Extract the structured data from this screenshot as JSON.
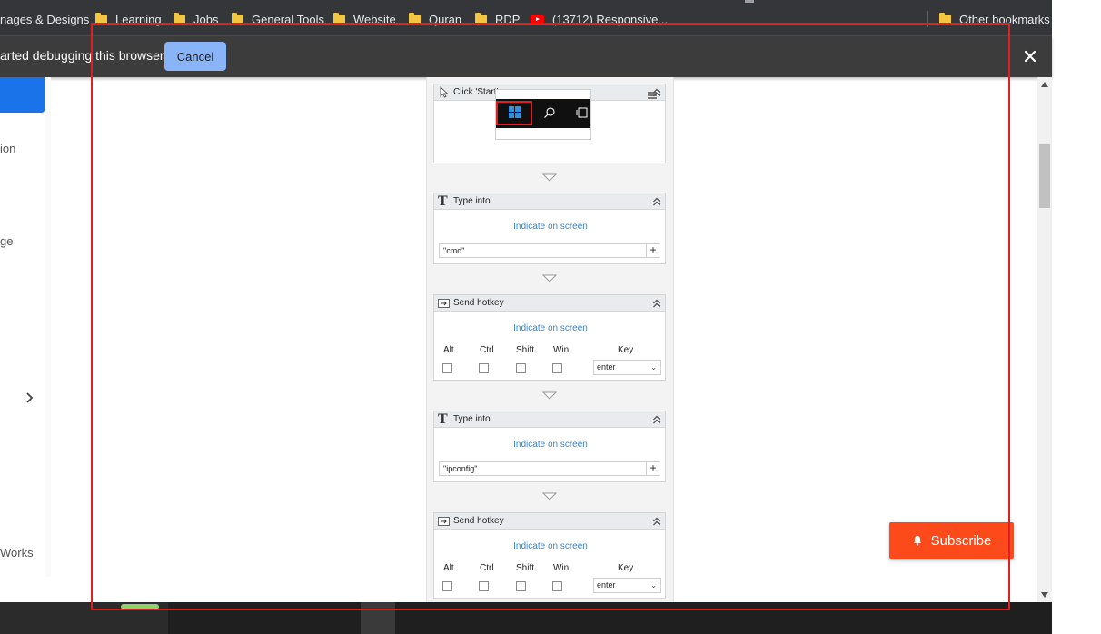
{
  "bookmarks": {
    "items": [
      {
        "label": "nages & Designs",
        "icon": ""
      },
      {
        "label": "Learning",
        "icon": "folder-icon"
      },
      {
        "label": "Jobs",
        "icon": "folder-icon"
      },
      {
        "label": "General Tools",
        "icon": "folder-icon"
      },
      {
        "label": "Website",
        "icon": "folder-icon"
      },
      {
        "label": "Quran",
        "icon": "folder-icon"
      },
      {
        "label": "RDP",
        "icon": "folder-icon"
      },
      {
        "label": "(13712) Responsive...",
        "icon": "youtube-icon"
      }
    ],
    "other": "Other bookmarks"
  },
  "debug_bar": {
    "message": "arted debugging this browser",
    "cancel_label": "Cancel"
  },
  "sidebar": {
    "items": [
      "ion",
      "ge",
      "Works"
    ]
  },
  "workflow": {
    "click_step": {
      "title": "Click 'Start'"
    },
    "type_step_1": {
      "title": "Type into",
      "indicate": "Indicate on screen",
      "value": "\"cmd\"",
      "plus": "+"
    },
    "hotkey_step_1": {
      "title": "Send hotkey",
      "indicate": "Indicate on screen",
      "labels": {
        "alt": "Alt",
        "ctrl": "Ctrl",
        "shift": "Shift",
        "win": "Win",
        "key": "Key"
      },
      "key_value": "enter"
    },
    "type_step_2": {
      "title": "Type into",
      "indicate": "Indicate on screen",
      "value": "\"ipconfig\"",
      "plus": "+"
    },
    "hotkey_step_2": {
      "title": "Send hotkey",
      "indicate": "Indicate on screen",
      "labels": {
        "alt": "Alt",
        "ctrl": "Ctrl",
        "shift": "Shift",
        "win": "Win",
        "key": "Key"
      },
      "key_value": "enter"
    }
  },
  "subscribe": {
    "label": "Subscribe"
  },
  "colors": {
    "accent_blue": "#1a73e8",
    "cancel_blue": "#8ab4f8",
    "subscribe_orange": "#fc4a1a",
    "selection_red": "#e02020",
    "link_blue": "#3b86c6"
  },
  "icons": [
    "folder-icon",
    "youtube-icon",
    "close-icon",
    "cursor-icon",
    "type-icon",
    "hotkey-icon",
    "collapse-icon",
    "menu-icon",
    "windows-icon",
    "search-icon",
    "task-view-icon",
    "chevron-right-icon",
    "bell-icon"
  ]
}
